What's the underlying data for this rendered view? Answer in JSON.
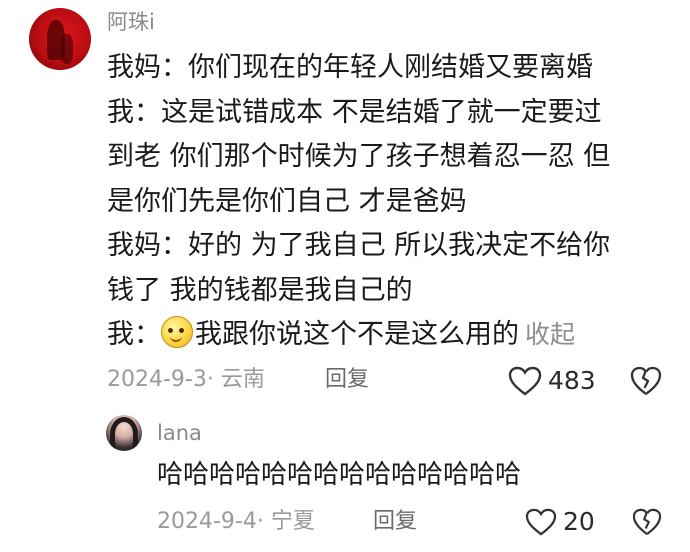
{
  "main_comment": {
    "username": "阿珠i",
    "lines": [
      "我妈：你们现在的年轻人刚结婚又要离婚",
      "我：这是试错成本 不是结婚了就一定要过",
      "到老 你们那个时候为了孩子想着忍一忍 但",
      "是你们先是你们自己 才是爸妈",
      "我妈：好的 为了我自己 所以我决定不给你",
      "钱了 我的钱都是我自己的"
    ],
    "last_line_prefix": "我：",
    "last_line_text": "我跟你说这个不是这么用的",
    "collapse_label": "收起",
    "emoji_icon": "grinning-face-icon",
    "date_location": "2024-9-3· 云南",
    "reply_label": "回复",
    "like_count": "483"
  },
  "reply_comment": {
    "username": "lana",
    "text": "哈哈哈哈哈哈哈哈哈哈哈哈哈哈",
    "date_location": "2024-9-4· 宁夏",
    "reply_label": "回复",
    "like_count": "20"
  }
}
